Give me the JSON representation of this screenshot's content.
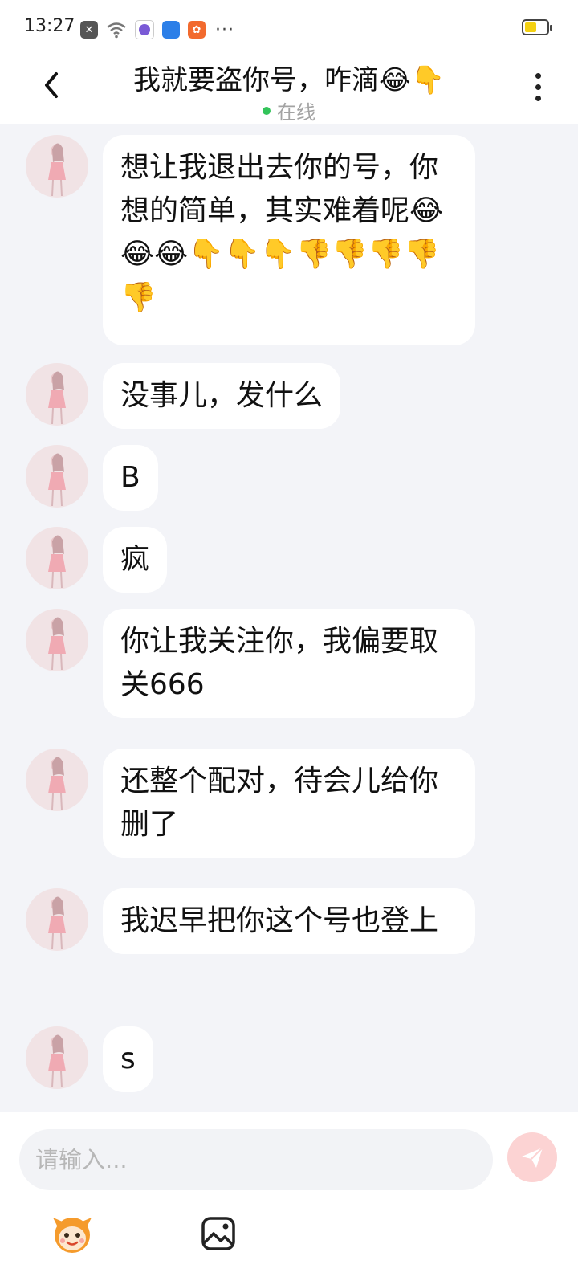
{
  "status_bar": {
    "time": "13:27",
    "icons": [
      "close-notification-icon",
      "wifi-icon",
      "app-icon-purple",
      "app-icon-blue",
      "app-icon-orange"
    ],
    "more": "···",
    "battery_level": 0.55
  },
  "header": {
    "title": "我就要盗你号，咋滴😂👇",
    "status": "在线"
  },
  "messages": [
    {
      "text": "想让我退出去你的号，你想的简单，其实难着呢😂😂😂👇👇👇👎👎👎👎👎"
    },
    {
      "text": "没事儿，发什么"
    },
    {
      "text": "B"
    },
    {
      "text": "疯"
    },
    {
      "text": "你让我关注你，我偏要取关666"
    },
    {
      "text": "还整个配对，待会儿给你删了"
    },
    {
      "text": "我迟早把你这个号也登上"
    },
    {
      "text": "s"
    }
  ],
  "composer": {
    "placeholder": "请输入..."
  },
  "colors": {
    "chat_background": "#f3f4f8",
    "online_dot": "#33c45a",
    "send_button": "#fcd3d3",
    "battery_fill": "#f4d112"
  }
}
